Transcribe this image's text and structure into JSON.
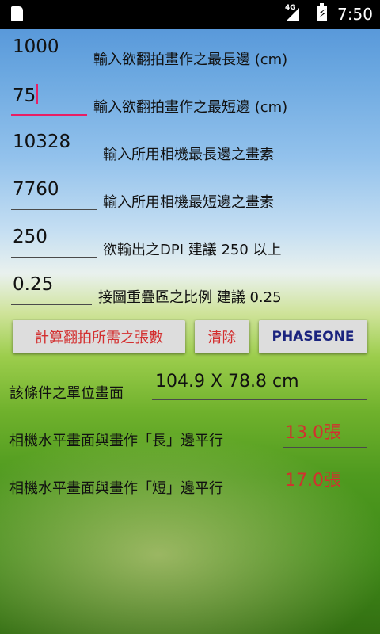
{
  "status": {
    "network": "4G",
    "time": "7:50"
  },
  "inputs": [
    {
      "value": "1000",
      "label": "輸入欲翻拍畫作之最長邊 (cm)"
    },
    {
      "value": "75",
      "label": "輸入欲翻拍畫作之最短邊 (cm)"
    },
    {
      "value": "10328",
      "label": "輸入所用相機最長邊之畫素"
    },
    {
      "value": "7760",
      "label": "輸入所用相機最短邊之畫素"
    },
    {
      "value": "250",
      "label": "欲輸出之DPI 建議 250 以上"
    },
    {
      "value": "0.25",
      "label": "接圖重疊區之比例 建議 0.25"
    }
  ],
  "buttons": {
    "calculate": "計算翻拍所需之張數",
    "clear": "清除",
    "phaseone": "PHASEONE"
  },
  "results": {
    "unit_label": "該條件之單位畫面",
    "unit_value": "104.9 X 78.8 cm",
    "long_label": "相機水平畫面與畫作「長」邊平行",
    "long_value": "13.0張",
    "short_label": "相機水平畫面與畫作「短」邊平行",
    "short_value": "17.0張"
  },
  "colors": {
    "accent": "#e91e63",
    "result_red": "#d32f2f",
    "button_blue": "#1a237e"
  }
}
